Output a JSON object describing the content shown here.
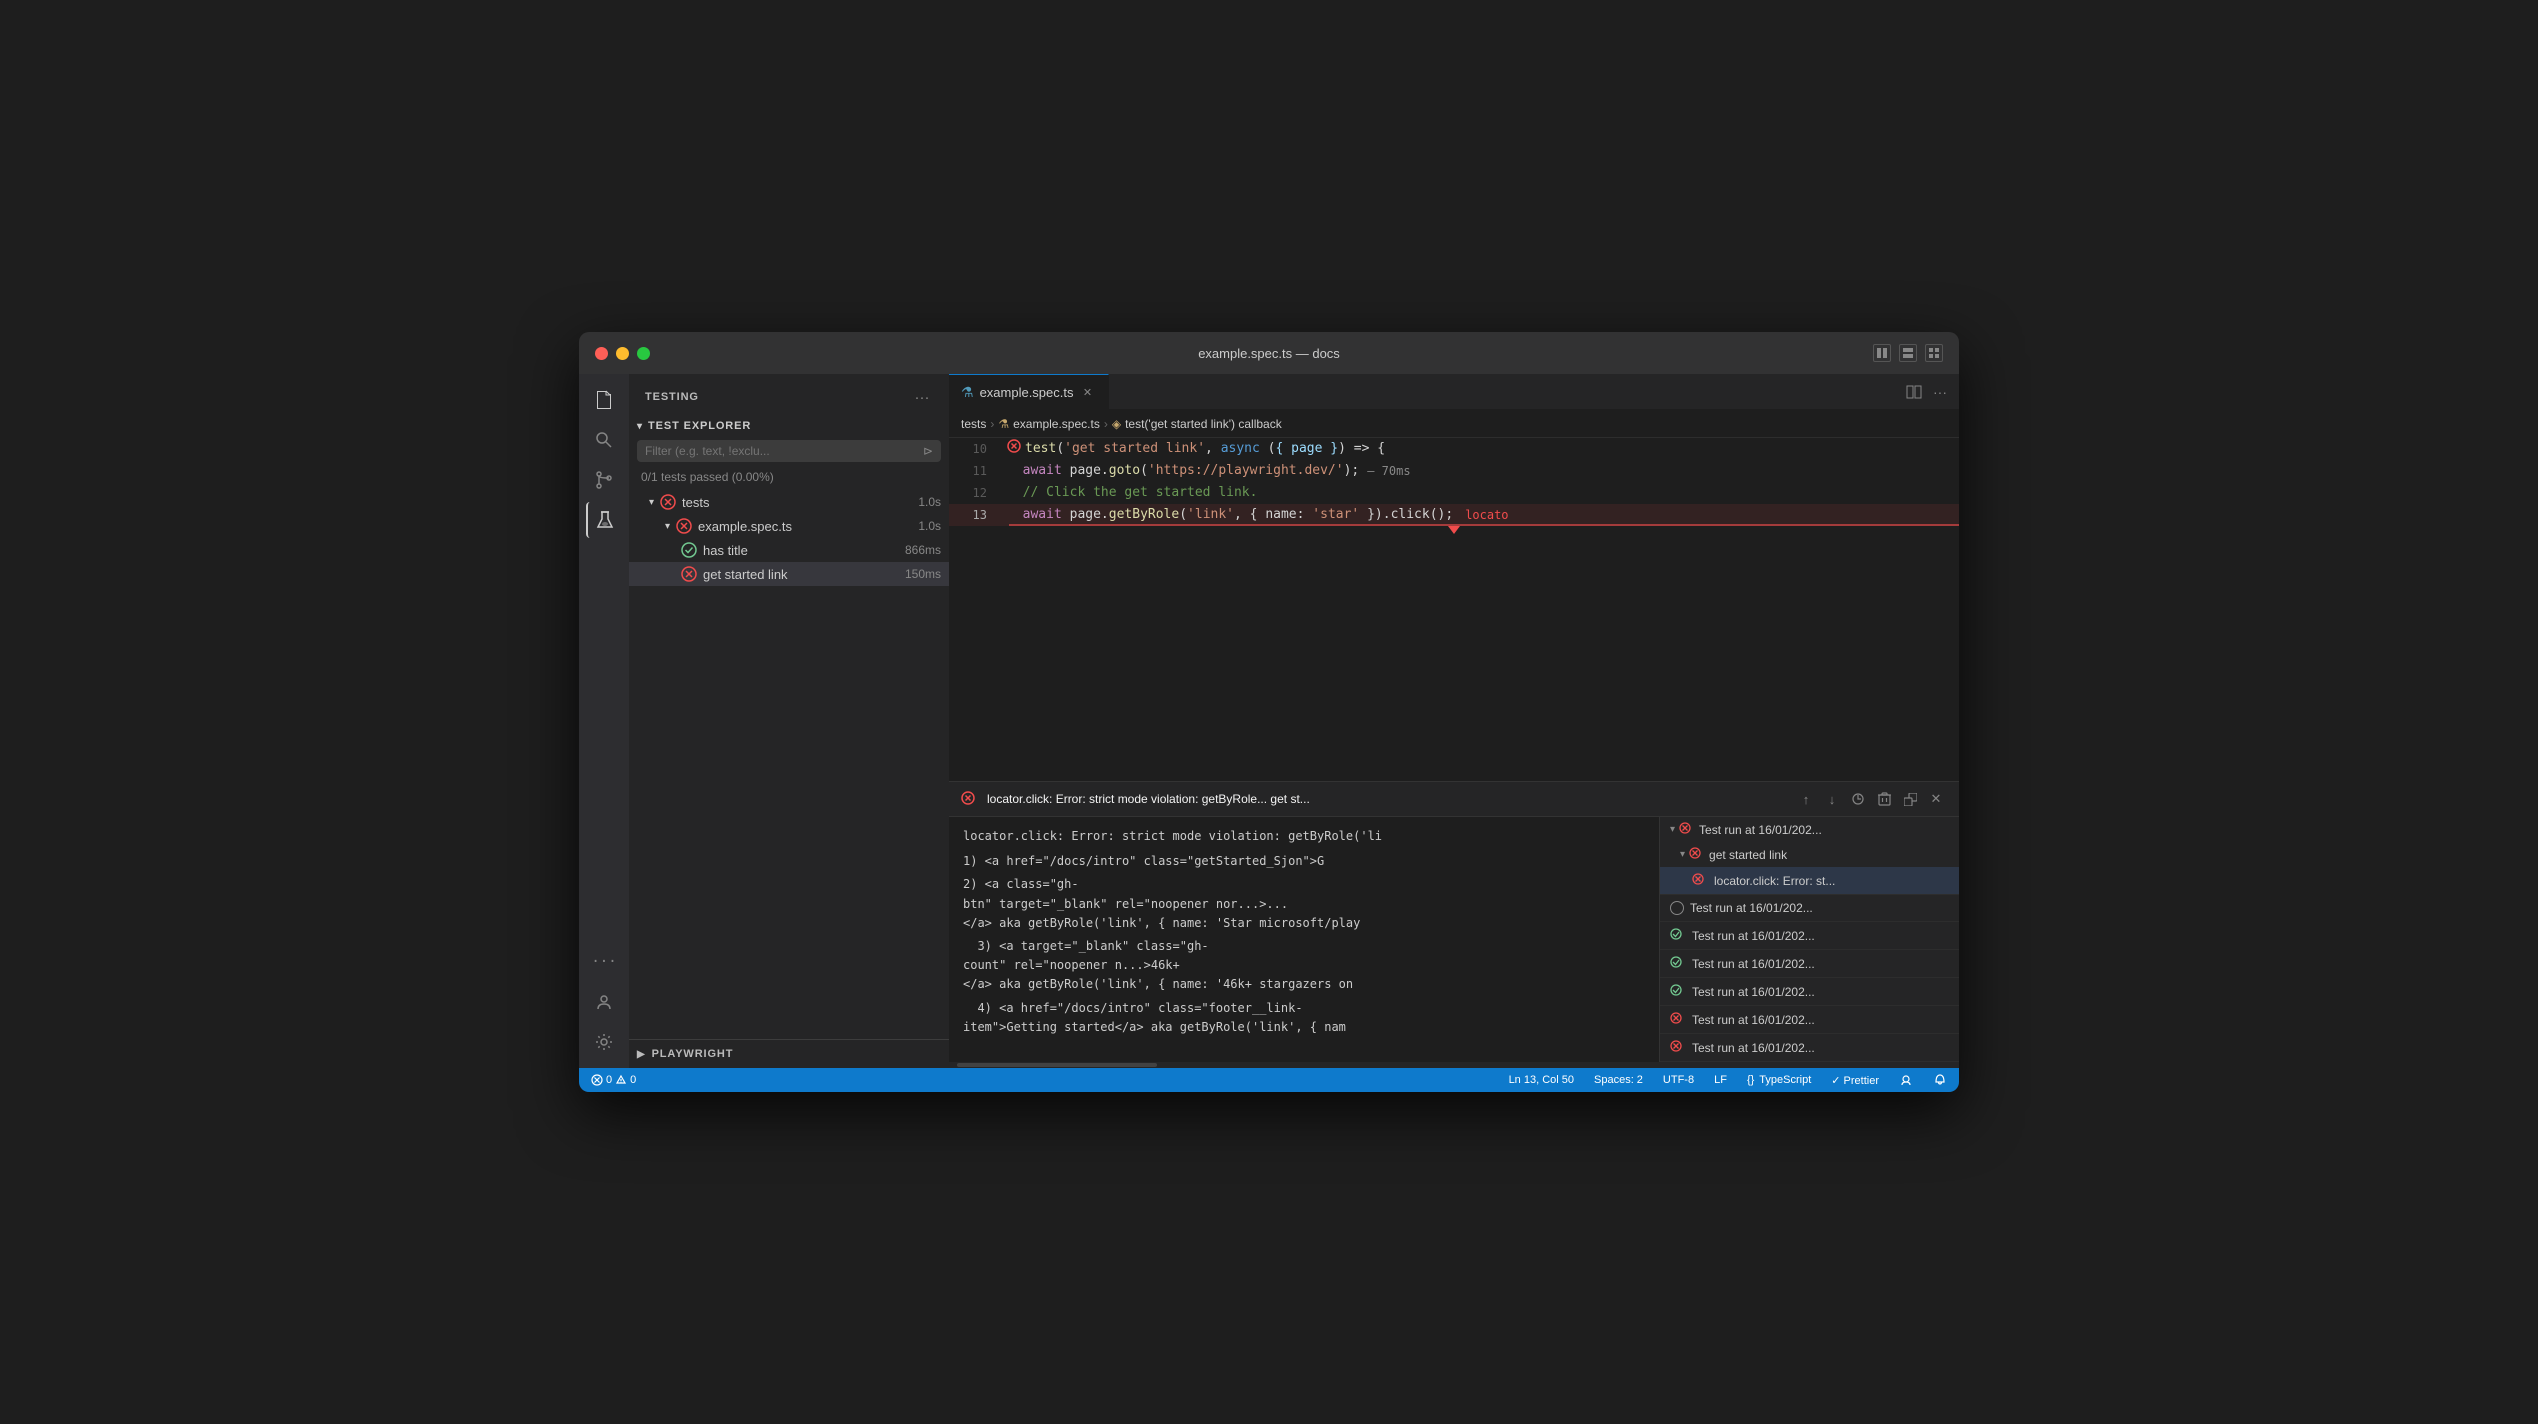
{
  "window": {
    "title": "example.spec.ts — docs",
    "traffic": {
      "close": "●",
      "min": "●",
      "max": "●"
    }
  },
  "activity_bar": {
    "icons": [
      {
        "name": "files-icon",
        "symbol": "⧉",
        "active": false
      },
      {
        "name": "search-icon",
        "symbol": "🔍",
        "active": false
      },
      {
        "name": "source-control-icon",
        "symbol": "⎇",
        "active": false
      },
      {
        "name": "test-flask-icon",
        "symbol": "⚗",
        "active": true
      },
      {
        "name": "more-icon",
        "symbol": "···",
        "active": false
      },
      {
        "name": "account-icon",
        "symbol": "👤",
        "active": false
      },
      {
        "name": "settings-icon",
        "symbol": "⚙",
        "active": false
      }
    ]
  },
  "sidebar": {
    "header": "TESTING",
    "more_btn": "···",
    "test_explorer": {
      "title": "TEST EXPLORER",
      "filter_placeholder": "Filter (e.g. text, !exclu...",
      "stats": "0/1 tests passed (0.00%)",
      "tree": [
        {
          "id": "tests",
          "label": "tests",
          "duration": "1.0s",
          "status": "error",
          "indent": 1,
          "expanded": true
        },
        {
          "id": "spec",
          "label": "example.spec.ts",
          "duration": "1.0s",
          "status": "error",
          "indent": 2,
          "expanded": true
        },
        {
          "id": "has-title",
          "label": "has title",
          "duration": "866ms",
          "status": "success",
          "indent": 3
        },
        {
          "id": "get-started",
          "label": "get started link",
          "duration": "150ms",
          "status": "error",
          "indent": 3
        }
      ]
    },
    "playwright": {
      "title": "PLAYWRIGHT"
    }
  },
  "editor": {
    "tab_label": "example.spec.ts",
    "breadcrumbs": [
      {
        "label": "tests",
        "type": "folder"
      },
      {
        "label": "example.spec.ts",
        "type": "file",
        "icon": "⚗"
      },
      {
        "label": "test('get started link') callback",
        "type": "block",
        "icon": "◈"
      }
    ],
    "code_lines": [
      {
        "num": "10",
        "content_parts": [
          {
            "text": "test",
            "class": "fn"
          },
          {
            "text": "('get started link', ",
            "class": "plain"
          },
          {
            "text": "async",
            "class": "kw"
          },
          {
            "text": " (",
            "class": "plain"
          },
          {
            "text": "{ page }",
            "class": "param"
          },
          {
            "text": ") => {",
            "class": "plain"
          }
        ],
        "has_error_icon": true
      },
      {
        "num": "11",
        "content_parts": [
          {
            "text": "  ",
            "class": "plain"
          },
          {
            "text": "await",
            "class": "await-kw"
          },
          {
            "text": " page.",
            "class": "plain"
          },
          {
            "text": "goto",
            "class": "fn"
          },
          {
            "text": "('",
            "class": "plain"
          },
          {
            "text": "https://playwright.dev/",
            "class": "str"
          },
          {
            "text": "');",
            "class": "plain"
          }
        ],
        "annotation": "— 70ms"
      },
      {
        "num": "12",
        "content_parts": [
          {
            "text": "  // Click the get started link.",
            "class": "comment"
          }
        ]
      },
      {
        "num": "13",
        "content_parts": [
          {
            "text": "  ",
            "class": "plain"
          },
          {
            "text": "await",
            "class": "await-kw"
          },
          {
            "text": " page.",
            "class": "plain"
          },
          {
            "text": "getByRole",
            "class": "fn"
          },
          {
            "text": "('link', { name: '",
            "class": "plain"
          },
          {
            "text": "star",
            "class": "str"
          },
          {
            "text": "' }).click();",
            "class": "plain"
          }
        ],
        "is_error_line": true,
        "inline_error": "locato"
      }
    ]
  },
  "error_panel": {
    "header_title": "locator.click: Error: strict mode violation: getByRole... get st...",
    "nav_up": "↑",
    "nav_down": "↓",
    "nav_history": "⟳",
    "nav_delete": "🗑",
    "nav_open": "⧉",
    "nav_close": "✕",
    "main_content": "locator.click: Error: strict mode violation: getByRole('li\n1) <a href=\"/docs/intro\" class=\"getStarted_Sjon\">G\n2) <a class=\"gh-\nbtn\" target=\"_blank\" rel=\"noopener nor...>...\n</a> aka getByRole('link', { name: 'Star microsoft/play\n3) <a target=\"_blank\" class=\"gh-\ncount\" rel=\"noopener n...>46k+\n</a> aka getByRole('link', { name: '46k+ stargazers on\n4) <a href=\"/docs/intro\" class=\"footer__link-\nitem\">Getting started</a> aka getByRole('link', { nam",
    "sidebar_items": [
      {
        "label": "Test run at 16/01/202...",
        "status": "error",
        "expanded": true,
        "indent": 0
      },
      {
        "label": "get started link",
        "status": "error",
        "expanded": true,
        "indent": 1,
        "active": true
      },
      {
        "label": "locator.click: Error: st...",
        "status": "error",
        "indent": 2,
        "sub": true,
        "active": true
      },
      {
        "label": "Test run at 16/01/202...",
        "status": "none",
        "indent": 0
      },
      {
        "label": "Test run at 16/01/202...",
        "status": "success",
        "indent": 0
      },
      {
        "label": "Test run at 16/01/202...",
        "status": "success",
        "indent": 0
      },
      {
        "label": "Test run at 16/01/202...",
        "status": "success",
        "indent": 0
      },
      {
        "label": "Test run at 16/01/202...",
        "status": "error",
        "indent": 0
      },
      {
        "label": "Test run at 16/01/202...",
        "status": "error",
        "indent": 0
      }
    ]
  },
  "scrollbar_label": "scroll",
  "status_bar": {
    "errors": "0",
    "warnings": "0",
    "position": "Ln 13, Col 50",
    "spaces": "Spaces: 2",
    "encoding": "UTF-8",
    "line_ending": "LF",
    "language": "TypeScript",
    "formatter": "✓ Prettier",
    "remote": "👤",
    "bell": "🔔"
  }
}
